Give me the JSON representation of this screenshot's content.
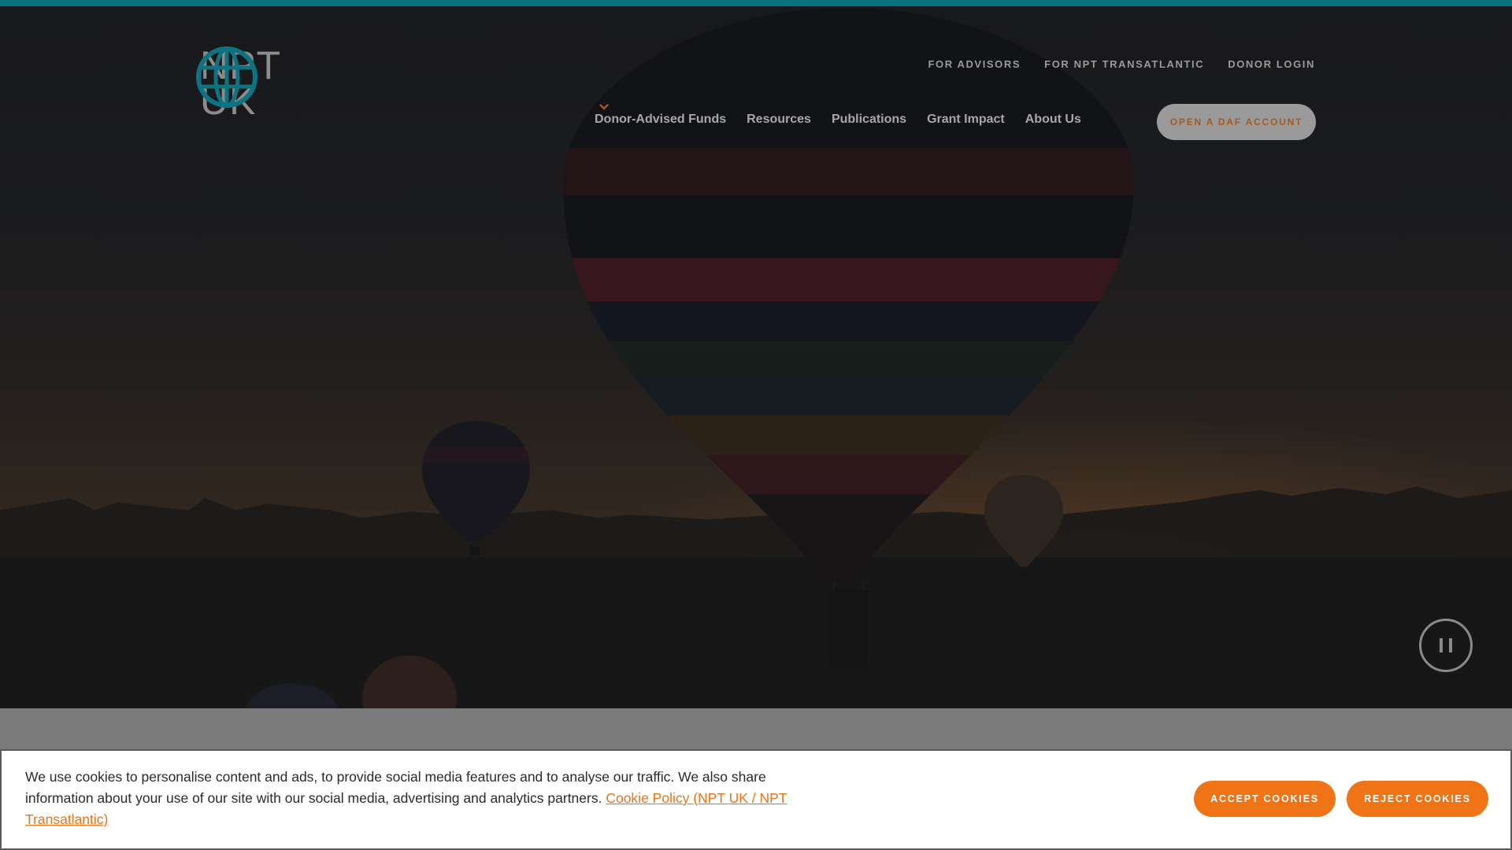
{
  "brand": {
    "logo_line1": "NPT",
    "logo_line2": "UK",
    "logo_color": "#0e7380",
    "accent": "#f07416"
  },
  "utility_nav": [
    {
      "label": "FOR ADVISORS"
    },
    {
      "label": "FOR NPT TRANSATLANTIC"
    },
    {
      "label": "DONOR LOGIN"
    }
  ],
  "main_nav": [
    {
      "label": "Donor-Advised Funds",
      "icon": "chevron-down-icon"
    },
    {
      "label": "Resources",
      "icon": "chevron-down-icon"
    },
    {
      "label": "Publications",
      "icon": "chevron-down-icon"
    },
    {
      "label": "Grant Impact",
      "icon": "chevron-down-icon"
    },
    {
      "label": "About Us",
      "icon": "chevron-down-icon"
    }
  ],
  "cta": {
    "label": "OPEN A DAF ACCOUNT"
  },
  "hero": {
    "pause_icon": "pause-icon"
  },
  "cookie": {
    "text": "We use cookies to personalise content and ads, to provide social media features and to analyse our traffic. We also share information about your use of our site with our social media, advertising and analytics partners. ",
    "link_label": "Cookie Policy (NPT UK / NPT Transatlantic)",
    "accept_label": "ACCEPT COOKIES",
    "reject_label": "REJECT COOKIES"
  }
}
